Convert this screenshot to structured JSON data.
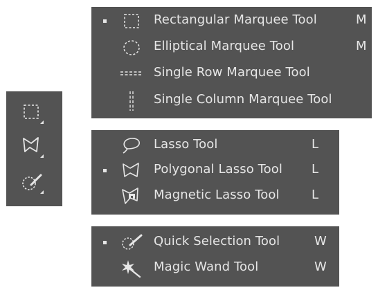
{
  "toolbar": {
    "buttons": [
      {
        "icon": "rectangular-marquee-icon"
      },
      {
        "icon": "polygonal-lasso-icon"
      },
      {
        "icon": "quick-selection-icon"
      }
    ]
  },
  "menus": {
    "marquee": {
      "items": [
        {
          "label": "Rectangular Marquee Tool",
          "key": "M",
          "active": true,
          "icon": "rectangular-marquee-icon"
        },
        {
          "label": "Elliptical Marquee Tool",
          "key": "M",
          "active": false,
          "icon": "elliptical-marquee-icon"
        },
        {
          "label": "Single Row Marquee Tool",
          "key": "",
          "active": false,
          "icon": "single-row-marquee-icon"
        },
        {
          "label": "Single Column Marquee Tool",
          "key": "",
          "active": false,
          "icon": "single-column-marquee-icon"
        }
      ]
    },
    "lasso": {
      "items": [
        {
          "label": "Lasso Tool",
          "key": "L",
          "active": false,
          "icon": "lasso-icon"
        },
        {
          "label": "Polygonal Lasso Tool",
          "key": "L",
          "active": true,
          "icon": "polygonal-lasso-icon"
        },
        {
          "label": "Magnetic Lasso Tool",
          "key": "L",
          "active": false,
          "icon": "magnetic-lasso-icon"
        }
      ]
    },
    "quick": {
      "items": [
        {
          "label": "Quick Selection Tool",
          "key": "W",
          "active": true,
          "icon": "quick-selection-icon"
        },
        {
          "label": "Magic Wand Tool",
          "key": "W",
          "active": false,
          "icon": "magic-wand-icon"
        }
      ]
    }
  },
  "colors": {
    "panel": "#535353",
    "text": "#e6e6e6"
  }
}
